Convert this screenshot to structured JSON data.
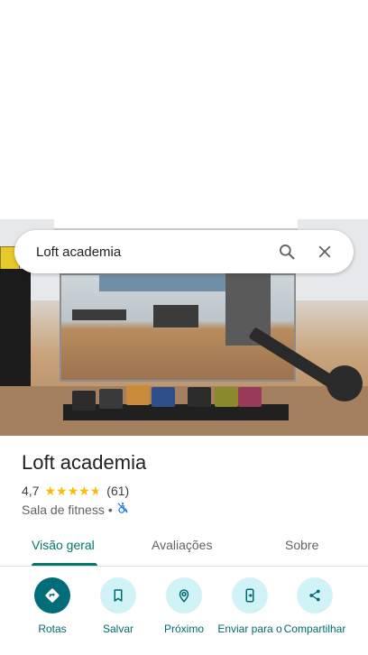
{
  "search": {
    "query": "Loft academia"
  },
  "place": {
    "name": "Loft academia",
    "rating": "4,7",
    "review_count": "(61)",
    "stars": 4.7,
    "category": "Sala de fitness",
    "separator": "•"
  },
  "tabs": [
    {
      "label": "Visão geral",
      "active": true
    },
    {
      "label": "Avaliações",
      "active": false
    },
    {
      "label": "Sobre",
      "active": false
    }
  ],
  "actions": [
    {
      "label": "Rotas",
      "icon": "directions-icon"
    },
    {
      "label": "Salvar",
      "icon": "bookmark-icon"
    },
    {
      "label": "Próximo",
      "icon": "nearby-icon"
    },
    {
      "label": "Enviar para o",
      "icon": "send-to-phone-icon"
    },
    {
      "label": "Compartilhar",
      "icon": "share-icon"
    }
  ],
  "colors": {
    "accent": "#00796b",
    "action_bg": "#d1f3f8",
    "primary_action": "#006d78",
    "star": "#fbbc04"
  }
}
